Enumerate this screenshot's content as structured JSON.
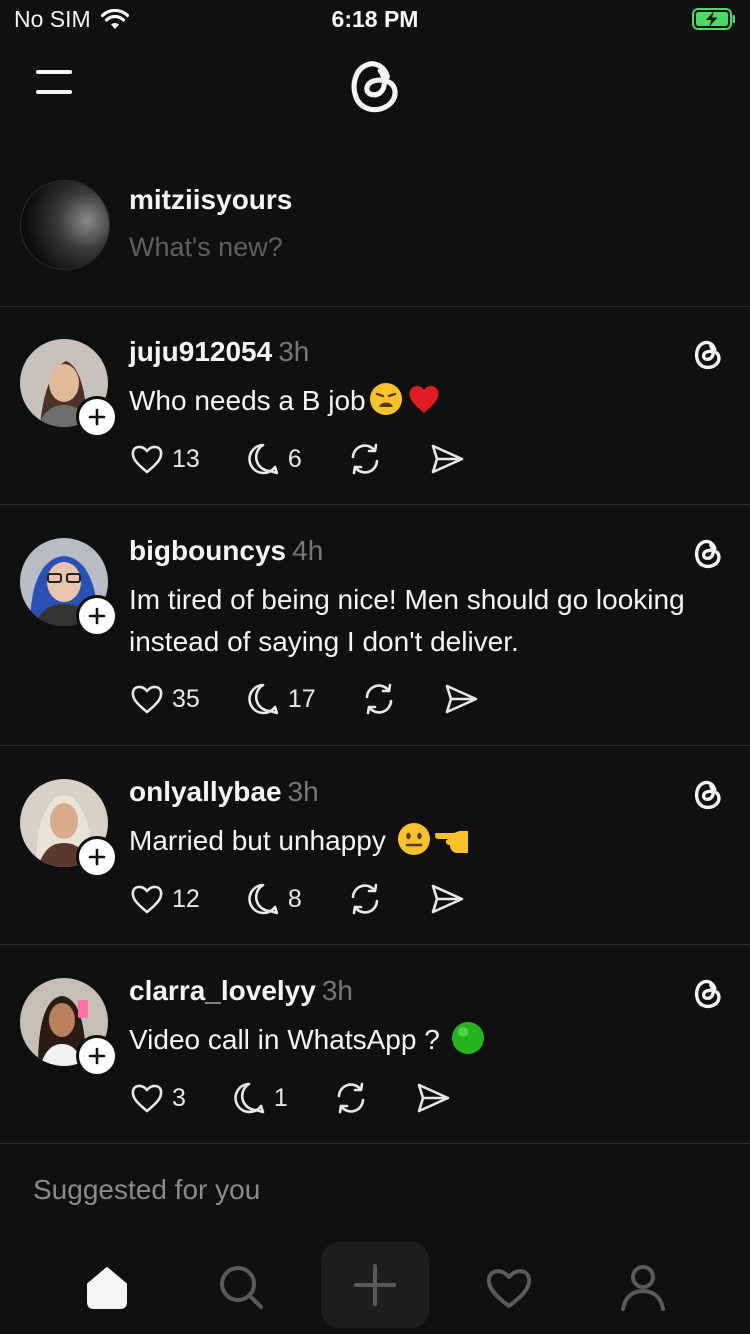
{
  "status_bar": {
    "carrier": "No SIM",
    "time": "6:18 PM"
  },
  "composer": {
    "username": "mitziisyours",
    "placeholder": "What's new?"
  },
  "posts": [
    {
      "username": "juju912054",
      "time": "3h",
      "text": "Who needs a B job",
      "emojis": [
        "weary-face",
        "red-heart"
      ],
      "likes": "13",
      "replies": "6"
    },
    {
      "username": "bigbouncys",
      "time": "4h",
      "text": "Im tired of being nice!  Men should go looking instead of saying I don't deliver.",
      "emojis": [],
      "likes": "35",
      "replies": "17"
    },
    {
      "username": "onlyallybae",
      "time": "3h",
      "text": "Married but unhappy",
      "emojis": [
        "neutral-face",
        "pointing-hand"
      ],
      "likes": "12",
      "replies": "8"
    },
    {
      "username": "clarra_lovelyy",
      "time": "3h",
      "text": "Video call in WhatsApp ?",
      "emojis": [
        "green-circle"
      ],
      "likes": "3",
      "replies": "1"
    }
  ],
  "suggested_label": "Suggested for you",
  "colors": {
    "background": "#101010",
    "text": "#f3f5f7",
    "muted": "#777777",
    "battery": "#4cd964",
    "heart": "#e0245e"
  }
}
